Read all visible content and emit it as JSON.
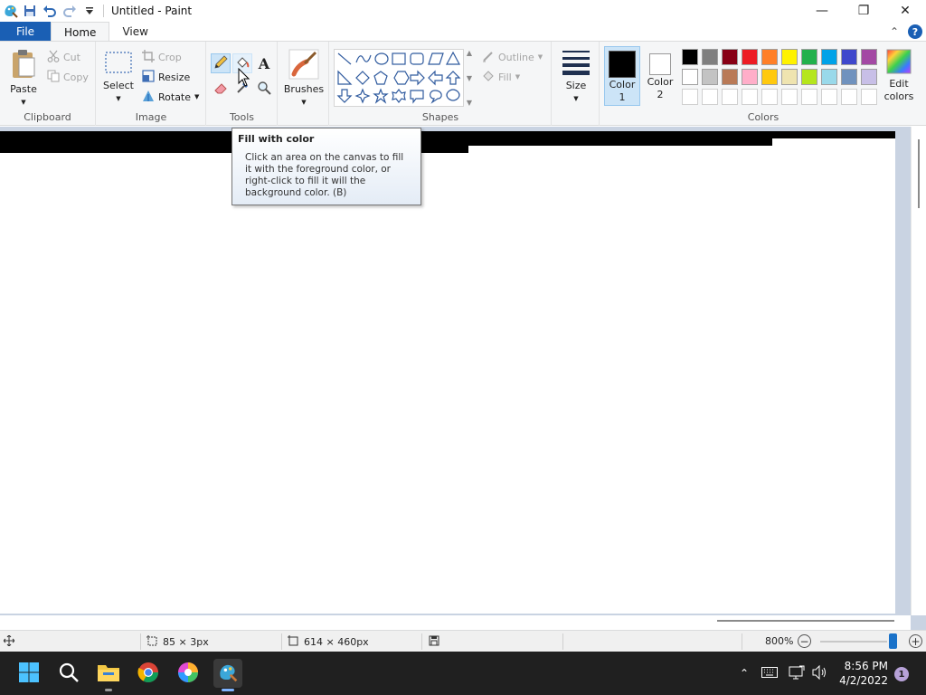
{
  "window": {
    "title": "Untitled - Paint",
    "minimize": "—",
    "maximize": "❐",
    "close": "✕"
  },
  "tabs": {
    "file": "File",
    "home": "Home",
    "view": "View"
  },
  "clipboard": {
    "paste": "Paste",
    "cut": "Cut",
    "copy": "Copy",
    "label": "Clipboard"
  },
  "image": {
    "select": "Select",
    "crop": "Crop",
    "resize": "Resize",
    "rotate": "Rotate",
    "label": "Image"
  },
  "tools": {
    "label": "Tools",
    "text_glyph": "A"
  },
  "brushes": {
    "label": "Brushes"
  },
  "shapes": {
    "outline": "Outline",
    "fill": "Fill",
    "label": "Shapes"
  },
  "size": {
    "label": "Size"
  },
  "colors": {
    "color1_line1": "Color",
    "color1_line2": "1",
    "color2_line1": "Color",
    "color2_line2": "2",
    "edit_line1": "Edit",
    "edit_line2": "colors",
    "label": "Colors",
    "color1": "#000000",
    "color2": "#ffffff",
    "palette_row1": [
      "#000000",
      "#7f7f7f",
      "#880015",
      "#ed1c24",
      "#ff7f27",
      "#fff200",
      "#22b14c",
      "#00a2e8",
      "#3f48cc",
      "#a349a4"
    ],
    "palette_row2": [
      "#ffffff",
      "#c3c3c3",
      "#b97a57",
      "#ffaec9",
      "#ffc90e",
      "#efe4b0",
      "#b5e61d",
      "#99d9ea",
      "#7092be",
      "#c8bfe7"
    ]
  },
  "tooltip": {
    "title": "Fill with color",
    "body": "Click an area on the canvas to fill it with the foreground color, or right-click to fill it will the background color. (B)"
  },
  "status": {
    "selection_size": "85 × 3px",
    "image_size": "614 × 460px",
    "zoom": "800%",
    "zoom_minus": "−",
    "zoom_plus": "+"
  },
  "taskbar": {
    "time": "8:56 PM",
    "date": "4/2/2022",
    "notifications": "1"
  }
}
